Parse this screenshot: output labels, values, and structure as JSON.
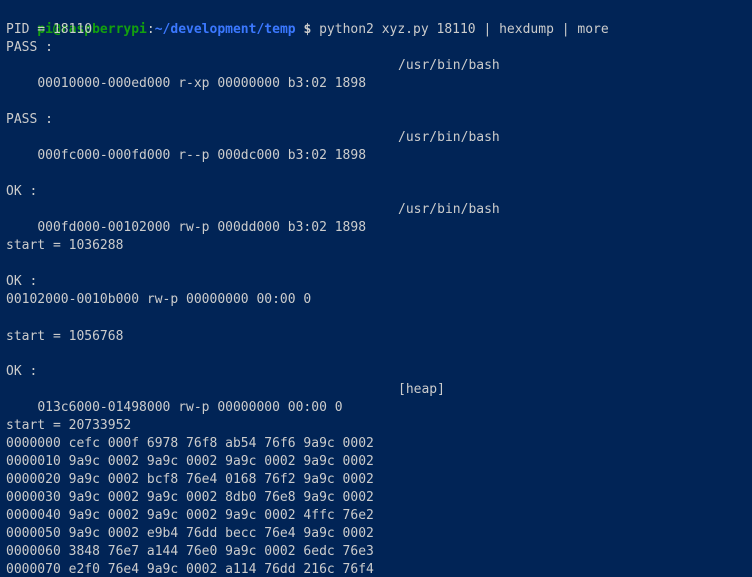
{
  "prompt": {
    "user_host": "pi@raspberrypi",
    "separator": ":",
    "path": "~/development/temp",
    "sign": "$",
    "command": " python2 xyz.py 18110 | hexdump | more"
  },
  "output": {
    "pid": "PID = 18110",
    "block1_status": "PASS :",
    "block1_map": "00010000-000ed000 r-xp 00000000 b3:02 1898",
    "block1_path": "/usr/bin/bash",
    "block2_status": "PASS :",
    "block2_map": "000fc000-000fd000 r--p 000dc000 b3:02 1898",
    "block2_path": "/usr/bin/bash",
    "block3_status": "OK :",
    "block3_map": "000fd000-00102000 rw-p 000dd000 b3:02 1898",
    "block3_path": "/usr/bin/bash",
    "block3_start": "start = 1036288",
    "block4_status": "OK :",
    "block4_map": "00102000-0010b000 rw-p 00000000 00:00 0",
    "block4_start": "start = 1056768",
    "block5_status": "OK :",
    "block5_map": "013c6000-01498000 rw-p 00000000 00:00 0",
    "block5_path": "[heap]",
    "block5_start": "start = 20733952"
  },
  "hexdump": [
    "0000000 cefc 000f 6978 76f8 ab54 76f6 9a9c 0002",
    "0000010 9a9c 0002 9a9c 0002 9a9c 0002 9a9c 0002",
    "0000020 9a9c 0002 bcf8 76e4 0168 76f2 9a9c 0002",
    "0000030 9a9c 0002 9a9c 0002 8db0 76e8 9a9c 0002",
    "0000040 9a9c 0002 9a9c 0002 9a9c 0002 4ffc 76e2",
    "0000050 9a9c 0002 e9b4 76dd becc 76e4 9a9c 0002",
    "0000060 3848 76e7 a144 76e0 9a9c 0002 6edc 76e3",
    "0000070 e2f0 76e4 9a9c 0002 a114 76dd 216c 76f4"
  ]
}
